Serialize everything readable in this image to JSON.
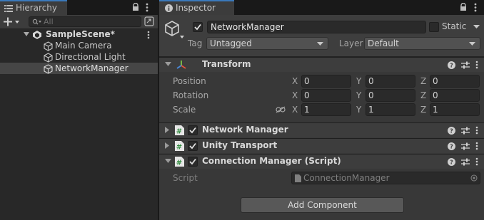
{
  "hierarchy": {
    "tab_label": "Hierarchy",
    "search_placeholder": "All",
    "scene_name": "SampleScene*",
    "items": [
      {
        "label": "Main Camera"
      },
      {
        "label": "Directional Light"
      },
      {
        "label": "NetworkManager",
        "selected": true
      }
    ]
  },
  "inspector": {
    "tab_label": "Inspector",
    "object_name": "NetworkManager",
    "object_active": true,
    "static_label": "Static",
    "static_checked": false,
    "tag_label": "Tag",
    "tag_value": "Untagged",
    "layer_label": "Layer",
    "layer_value": "Default",
    "transform": {
      "title": "Transform",
      "position_label": "Position",
      "rotation_label": "Rotation",
      "scale_label": "Scale",
      "axis_x": "X",
      "axis_y": "Y",
      "axis_z": "Z",
      "position": [
        "0",
        "0",
        "0"
      ],
      "rotation": [
        "0",
        "0",
        "0"
      ],
      "scale": [
        "1",
        "1",
        "1"
      ]
    },
    "components": [
      {
        "title": "Network Manager",
        "enabled": true
      },
      {
        "title": "Unity Transport",
        "enabled": true
      },
      {
        "title": "Connection Manager (Script)",
        "enabled": true
      }
    ],
    "script_label": "Script",
    "script_value": "ConnectionManager",
    "add_component_label": "Add Component"
  },
  "colors": {
    "accent": "#3a79bb",
    "panel_bg": "#383838",
    "selection": "#464646"
  }
}
